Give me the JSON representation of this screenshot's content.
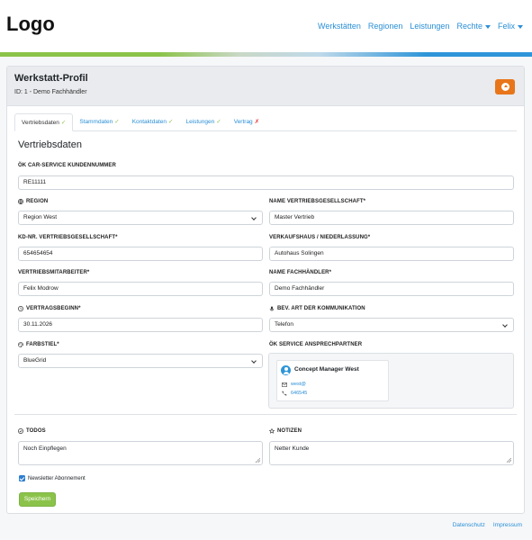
{
  "header": {
    "logo": "Logo",
    "nav": [
      "Werkstätten",
      "Regionen",
      "Leistungen",
      "Rechte",
      "Felix"
    ]
  },
  "profile": {
    "title": "Werkstatt-Profil",
    "subtitle": "ID: 1 - Demo Fachhändler",
    "upload_icon": "upload-circle-icon"
  },
  "tabs": [
    {
      "label": "Vertriebsdaten",
      "mark": "✓",
      "status": "ok"
    },
    {
      "label": "Stammdaten",
      "mark": "✓",
      "status": "ok"
    },
    {
      "label": "Kontaktdaten",
      "mark": "✓",
      "status": "ok"
    },
    {
      "label": "Leistungen",
      "mark": "✓",
      "status": "ok"
    },
    {
      "label": "Vertrag",
      "mark": "✗",
      "status": "missing"
    }
  ],
  "section_title": "Vertriebsdaten",
  "fields": {
    "kundennummer": {
      "label": "ÖK Car-Service Kundennummer",
      "value": "RE11111"
    },
    "region": {
      "label": "Region",
      "value": "Region West",
      "icon": "globe-icon"
    },
    "name_vertriebsgesellschaft": {
      "label": "Name Vertriebsgesellschaft*",
      "value": "Master Vertrieb"
    },
    "kd_nr": {
      "label": "KD-Nr. Vertriebsgesellschaft*",
      "value": "654654654"
    },
    "verkaufshaus": {
      "label": "Verkaufshaus / Niederlassung*",
      "value": "Autohaus Solingen"
    },
    "vertriebsmitarbeiter": {
      "label": "Vertriebsmitarbeiter*",
      "value": "Felix Modrow"
    },
    "name_fachhaendler": {
      "label": "Name Fachhändler*",
      "value": "Demo Fachhändler"
    },
    "vertragsbeginn": {
      "label": "Vertragsbeginn*",
      "value": "30.11.2026",
      "icon": "clock-icon"
    },
    "kommunikation": {
      "label": "Bev. Art der Kommunikation",
      "value": "Telefon",
      "icon": "microphone-icon"
    },
    "farbstiel": {
      "label": "Farbstiel*",
      "value": "BlueGrid",
      "icon": "palette-icon"
    },
    "ansprechpartner": {
      "label": "ÖK Service Ansprechpartner"
    }
  },
  "contact": {
    "name": "Concept Manager West",
    "email": "west@",
    "phone": "646545"
  },
  "todos": {
    "label": "Todos",
    "value": "Noch Einpflegen",
    "icon": "check-circle-icon"
  },
  "notizen": {
    "label": "Notizen",
    "value": "Netter Kunde",
    "icon": "star-icon"
  },
  "newsletter": {
    "label": "Newsletter Abonnement",
    "checked": true
  },
  "save_label": "Speichern",
  "footer": [
    "Datenschutz",
    "Impressum"
  ],
  "colors": {
    "accent_blue": "#2a8fd6",
    "accent_green": "#8bc34a",
    "accent_orange": "#e8751a"
  }
}
